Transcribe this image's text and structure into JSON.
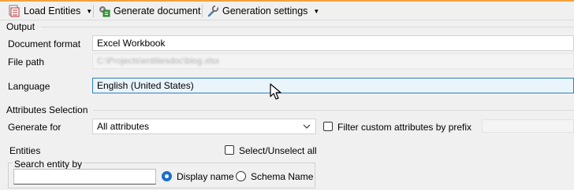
{
  "toolbar": {
    "load_entities_label": "Load Entities",
    "generate_document_label": "Generate document",
    "generation_settings_label": "Generation settings"
  },
  "output": {
    "section_title": "Output",
    "document_format": {
      "label": "Document format",
      "value": "Excel Workbook"
    },
    "file_path": {
      "label": "File path",
      "value": "C:\\Projects\\entitiesdoc\\blog.xlsx"
    },
    "language": {
      "label": "Language",
      "value": "English (United States)"
    }
  },
  "attributes_selection": {
    "section_title": "Attributes Selection",
    "generate_for": {
      "label": "Generate for",
      "value": "All attributes"
    },
    "filter_custom_label": "Filter custom attributes by prefix"
  },
  "entities": {
    "label": "Entities",
    "select_unselect_all_label": "Select/Unselect all",
    "search_group_title": "Search entity by",
    "search_value": "",
    "display_name_label": "Display name",
    "schema_name_label": "Schema Name",
    "selected_option": "Display name"
  },
  "colors": {
    "accent_top": "#f0a23a",
    "focus_border": "#2c7fbf",
    "radio_selected": "#1a6fc9"
  }
}
